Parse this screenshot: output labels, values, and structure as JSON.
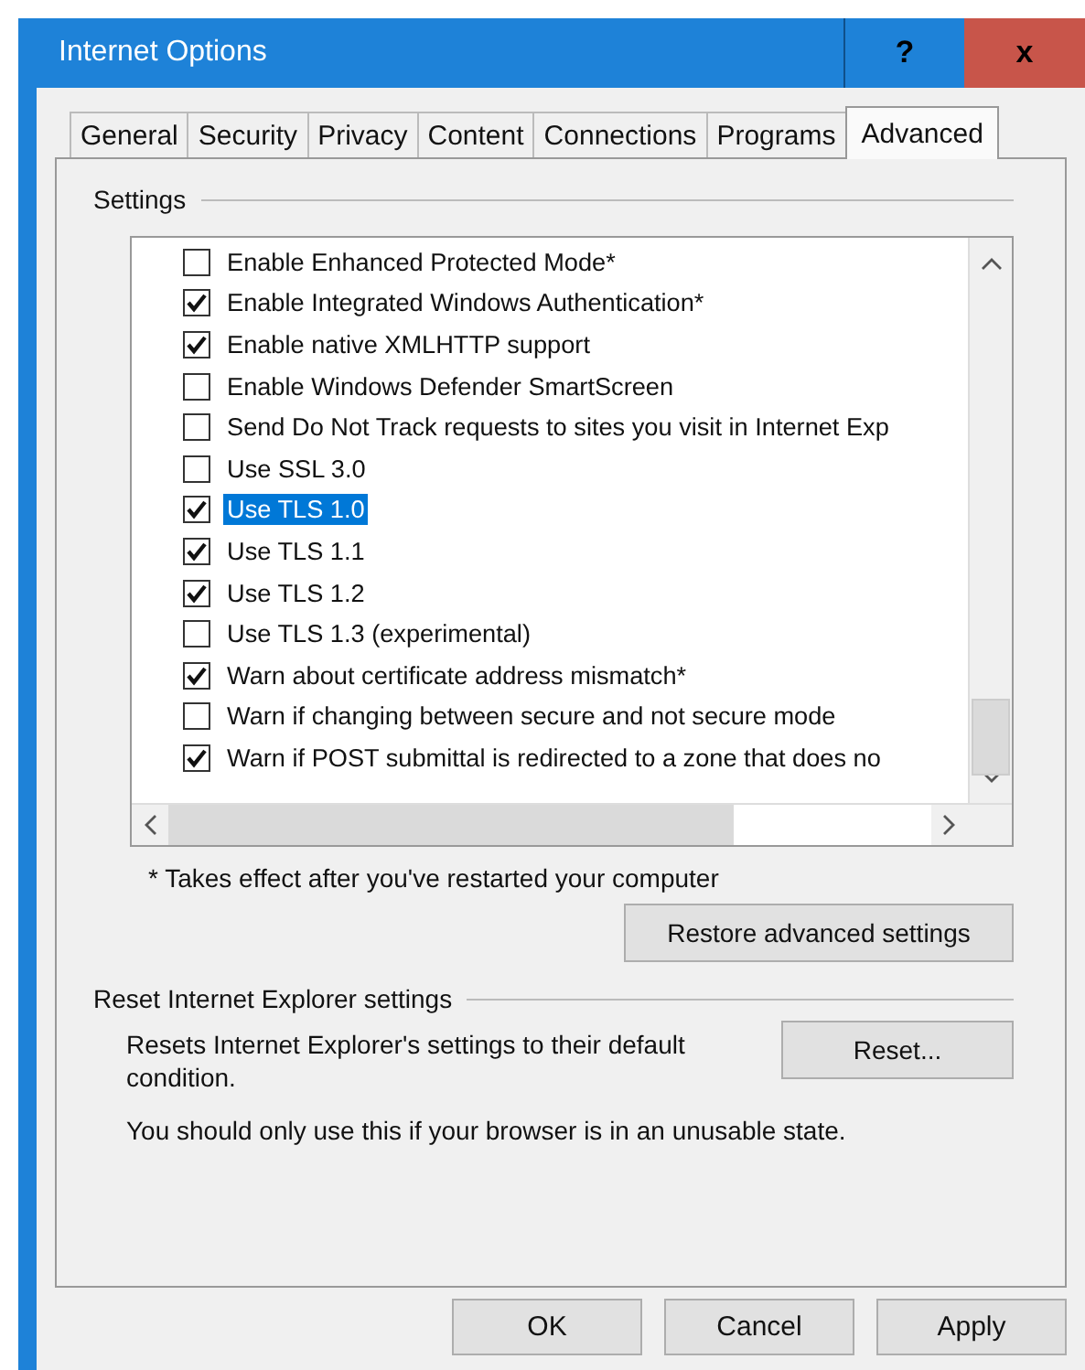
{
  "window": {
    "title": "Internet Options",
    "help_button": "?",
    "close_button": "x"
  },
  "tabs": [
    {
      "label": "General",
      "selected": false
    },
    {
      "label": "Security",
      "selected": false
    },
    {
      "label": "Privacy",
      "selected": false
    },
    {
      "label": "Content",
      "selected": false
    },
    {
      "label": "Connections",
      "selected": false
    },
    {
      "label": "Programs",
      "selected": false
    },
    {
      "label": "Advanced",
      "selected": true
    }
  ],
  "settings": {
    "label": "Settings",
    "options": [
      {
        "label": "Enable Enhanced Protected Mode*",
        "checked": false,
        "selected": false
      },
      {
        "label": "Enable Integrated Windows Authentication*",
        "checked": true,
        "selected": false
      },
      {
        "label": "Enable native XMLHTTP support",
        "checked": true,
        "selected": false
      },
      {
        "label": "Enable Windows Defender SmartScreen",
        "checked": false,
        "selected": false
      },
      {
        "label": "Send Do Not Track requests to sites you visit in Internet Exp",
        "checked": false,
        "selected": false
      },
      {
        "label": "Use SSL 3.0",
        "checked": false,
        "selected": false
      },
      {
        "label": "Use TLS 1.0",
        "checked": true,
        "selected": true
      },
      {
        "label": "Use TLS 1.1",
        "checked": true,
        "selected": false
      },
      {
        "label": "Use TLS 1.2",
        "checked": true,
        "selected": false
      },
      {
        "label": "Use TLS 1.3 (experimental)",
        "checked": false,
        "selected": false
      },
      {
        "label": "Warn about certificate address mismatch*",
        "checked": true,
        "selected": false
      },
      {
        "label": "Warn if changing between secure and not secure mode",
        "checked": false,
        "selected": false
      },
      {
        "label": "Warn if POST submittal is redirected to a zone that does no",
        "checked": true,
        "selected": false
      }
    ],
    "footnote": "* Takes effect after you've restarted your computer",
    "restore_button": "Restore advanced settings"
  },
  "reset": {
    "label": "Reset Internet Explorer settings",
    "description": "Resets Internet Explorer's settings to their default condition.",
    "button": "Reset...",
    "warning": "You should only use this if your browser is in an unusable state."
  },
  "buttons": [
    "OK",
    "Cancel",
    "Apply"
  ]
}
